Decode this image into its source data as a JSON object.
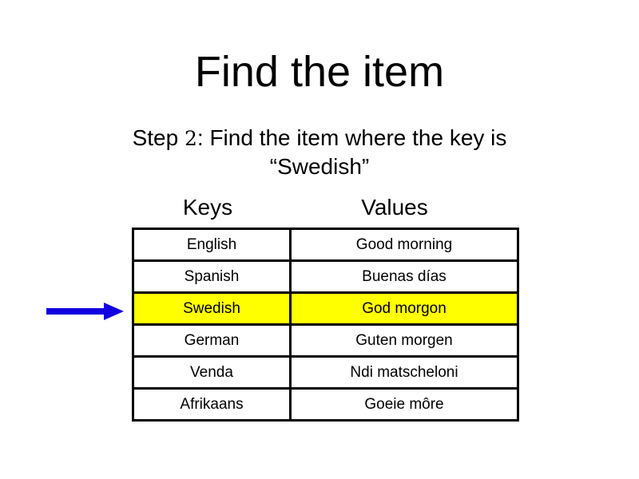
{
  "slide": {
    "title": "Find the item",
    "subtitle_prefix": "Step ",
    "subtitle_step_number": "2",
    "subtitle_suffix": ": Find the item where the key is “Swedish”",
    "background_color": "#FFFFFF",
    "text_color": "#000000"
  },
  "table": {
    "headers": {
      "keys": "Keys",
      "values": "Values"
    },
    "highlight_color": "#FFFF00",
    "border_color": "#000000",
    "rows": [
      {
        "key": "English",
        "value": "Good morning",
        "highlighted": false
      },
      {
        "key": "Spanish",
        "value": "Buenas días",
        "highlighted": false
      },
      {
        "key": "Swedish",
        "value": "God morgon",
        "highlighted": true
      },
      {
        "key": "German",
        "value": "Guten morgen",
        "highlighted": false
      },
      {
        "key": "Venda",
        "value": "Ndi matscheloni",
        "highlighted": false
      },
      {
        "key": "Afrikaans",
        "value": "Goeie môre",
        "highlighted": false
      }
    ]
  },
  "annotation": {
    "arrow": {
      "icon": "arrow-right-icon",
      "color": "#1200E0",
      "points_to_row_key": "Swedish",
      "direction": "right"
    }
  }
}
